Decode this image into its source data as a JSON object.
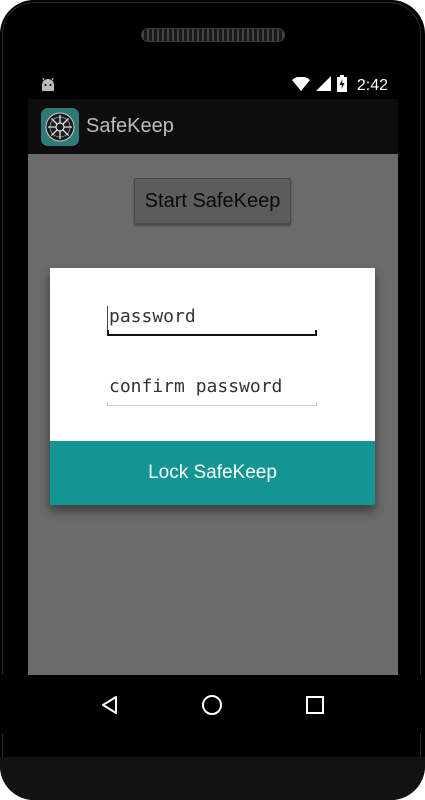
{
  "status_bar": {
    "time": "2:42",
    "icons": [
      "android-notification-icon",
      "wifi-icon",
      "cell-signal-icon",
      "battery-icon"
    ]
  },
  "action_bar": {
    "app_icon": "safekeep-app-icon",
    "title": "SafeKeep"
  },
  "content": {
    "start_button_label": "Start SafeKeep"
  },
  "dialog": {
    "password_placeholder": "password",
    "confirm_placeholder": "confirm password",
    "lock_button_label": "Lock SafeKeep",
    "accent_color": "#129593"
  },
  "nav_bar": {
    "icons": [
      "back-icon",
      "home-icon",
      "recents-icon"
    ]
  }
}
